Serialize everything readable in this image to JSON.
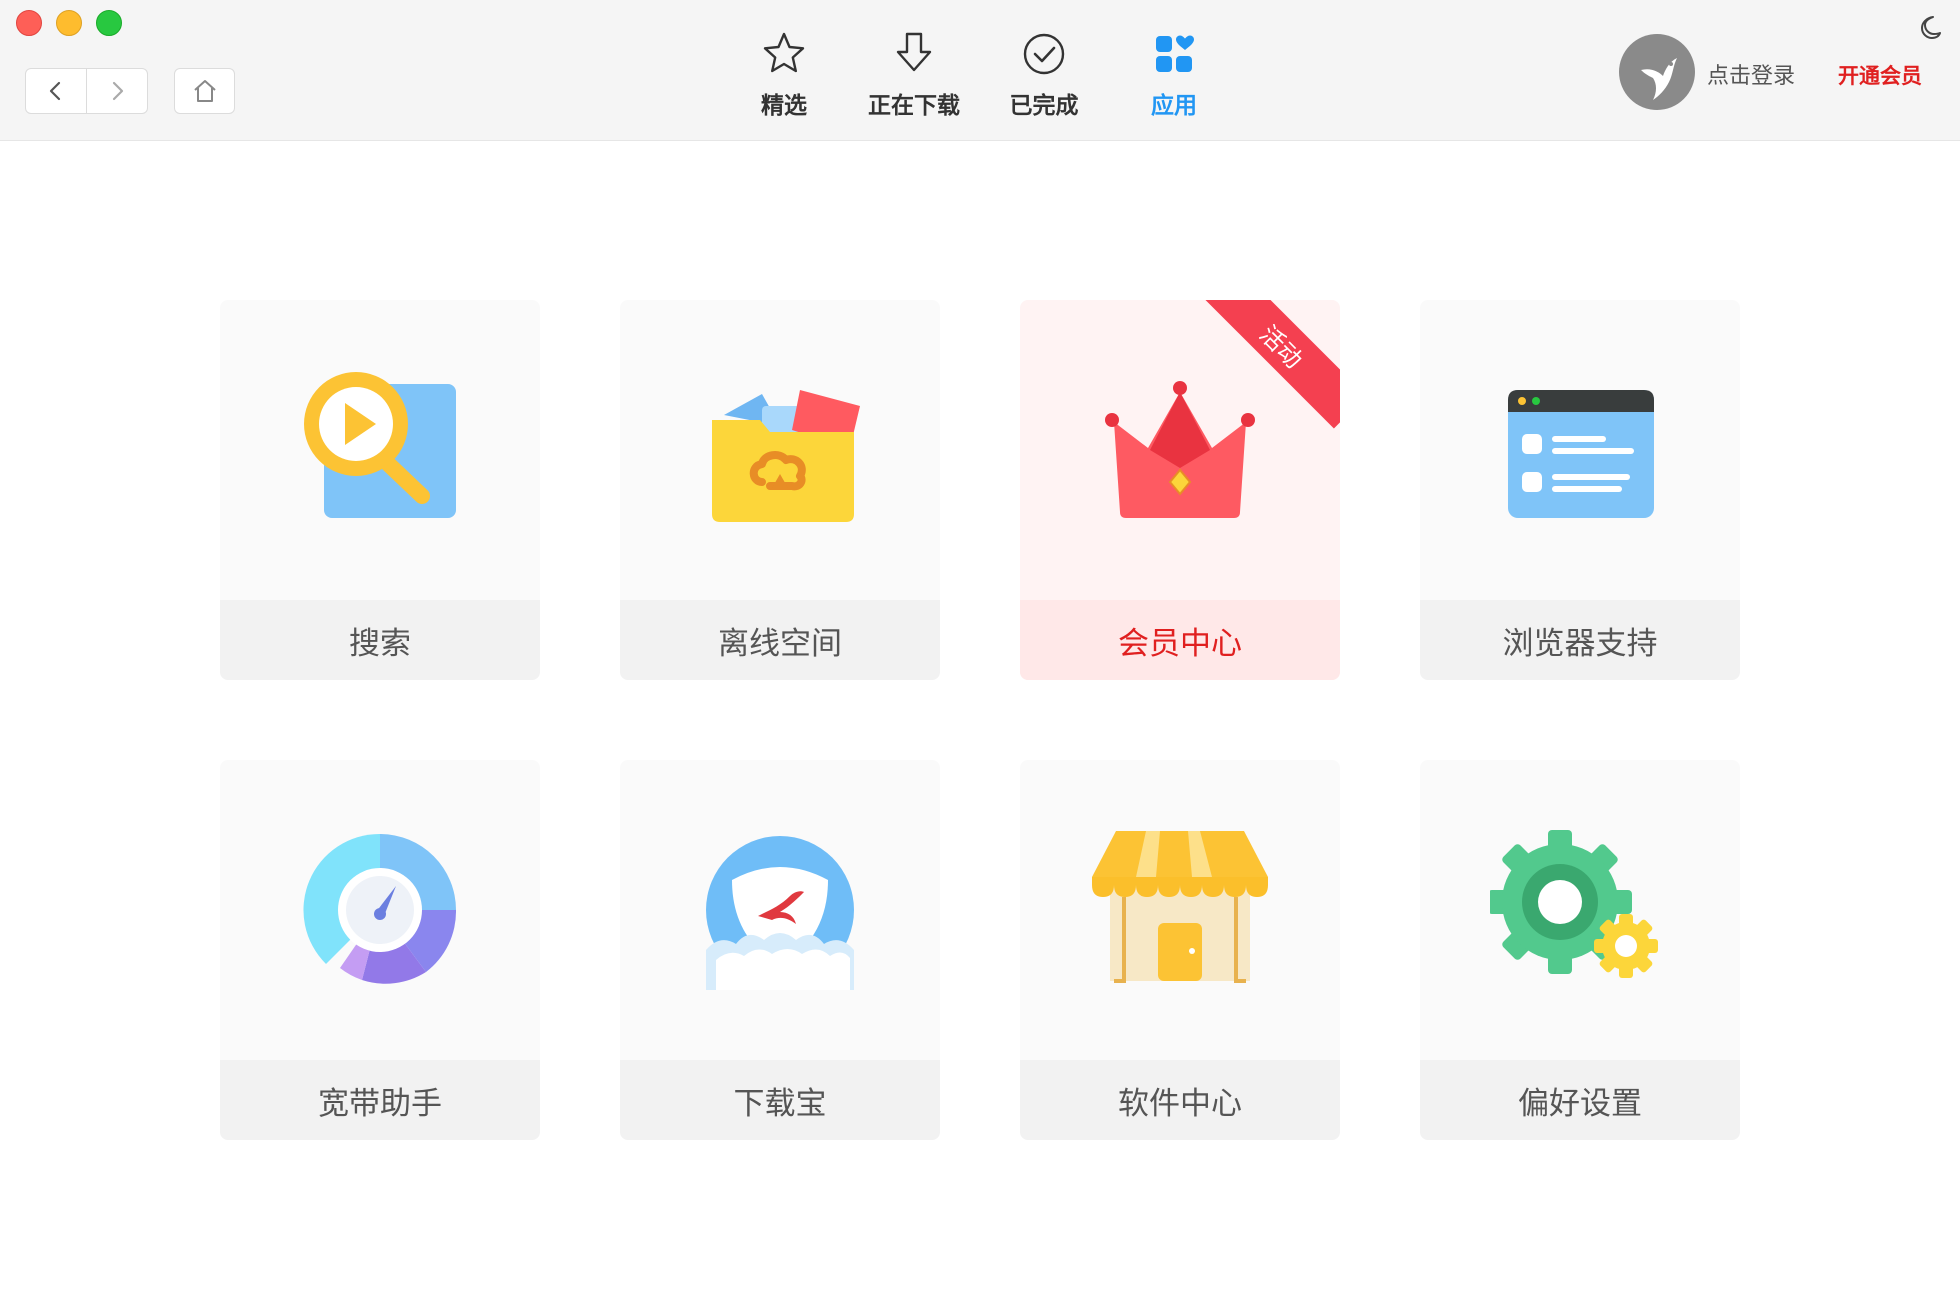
{
  "toolbar": {
    "tabs": [
      {
        "label": "精选",
        "icon": "star-icon"
      },
      {
        "label": "正在下载",
        "icon": "download-arrow-icon"
      },
      {
        "label": "已完成",
        "icon": "check-circle-icon"
      },
      {
        "label": "应用",
        "icon": "apps-grid-icon",
        "active": true
      }
    ],
    "login_label": "点击登录",
    "vip_label": "开通会员"
  },
  "apps": [
    {
      "label": "搜索",
      "icon": "search-play-icon"
    },
    {
      "label": "离线空间",
      "icon": "cloud-folder-icon"
    },
    {
      "label": "会员中心",
      "icon": "crown-icon",
      "badge": "活动"
    },
    {
      "label": "浏览器支持",
      "icon": "browser-window-icon"
    },
    {
      "label": "宽带助手",
      "icon": "speed-gauge-icon"
    },
    {
      "label": "下载宝",
      "icon": "shield-bird-icon"
    },
    {
      "label": "软件中心",
      "icon": "store-icon"
    },
    {
      "label": "偏好设置",
      "icon": "gears-icon"
    }
  ],
  "colors": {
    "accent": "#2196f3",
    "vip_red": "#e02020",
    "ribbon": "#f44050"
  }
}
